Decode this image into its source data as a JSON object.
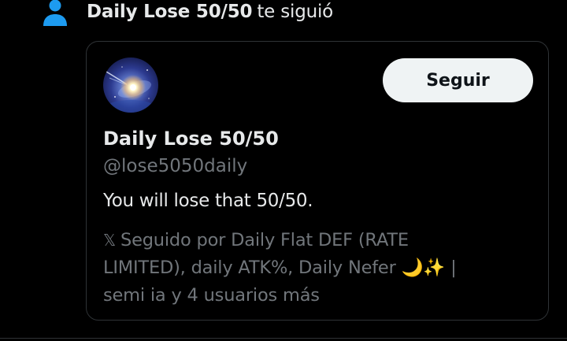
{
  "notification": {
    "name": "Daily Lose 50/50",
    "action": "te siguió",
    "icon": "person-icon",
    "icon_color": "#1d9bf0"
  },
  "card": {
    "follow_label": "Seguir",
    "display_name": "Daily Lose 50/50",
    "handle": "@lose5050daily",
    "bio": "You will lose that 50/50.",
    "followed_by_icon": "x-logo-icon",
    "followed_by_mark": "𝕏",
    "followed_by": "Seguido por Daily Flat DEF (RATE\nLIMITED), daily ATK%, Daily Nefer 🌙✨ |\nsemi ia y 4 usuarios más"
  },
  "colors": {
    "background": "#000000",
    "text_primary": "#e7e9ea",
    "text_secondary": "#71767b",
    "border": "#2f3336",
    "button_bg": "#eff3f4",
    "button_text": "#0f1419",
    "accent": "#1d9bf0"
  }
}
